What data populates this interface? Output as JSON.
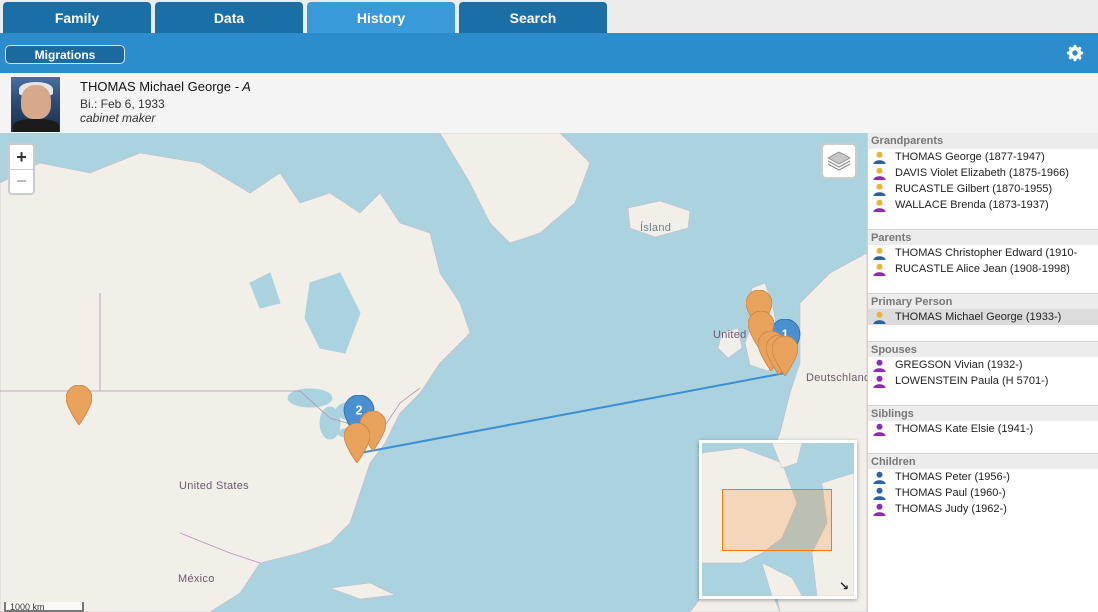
{
  "tabs": [
    {
      "label": "Family",
      "active": false
    },
    {
      "label": "Data",
      "active": false
    },
    {
      "label": "History",
      "active": true
    },
    {
      "label": "Search",
      "active": false
    }
  ],
  "toolbar": {
    "migrations_label": "Migrations",
    "settings_icon": "gear-icon"
  },
  "person": {
    "name": "THOMAS Michael George",
    "name_suffix": " - A",
    "birth": "Bi.: Feb 6, 1933",
    "occupation": "cabinet maker"
  },
  "map": {
    "zoom_in": "+",
    "zoom_out": "−",
    "labels": {
      "island": "Ísland",
      "united_kingdom": "United",
      "deutschland": "Deutschland",
      "united_states": "United States",
      "mexico": "México"
    },
    "scale": "1000 km",
    "marker_color": "#e8a25c",
    "cluster_color": "#4a90d0",
    "clusters": [
      {
        "count": "2"
      },
      {
        "count": "1"
      }
    ],
    "minimap_toggle": "↘"
  },
  "sidebar": {
    "sections": [
      {
        "title": "Grandparents",
        "people": [
          {
            "label": "THOMAS George (1877-1947)",
            "gender": "male"
          },
          {
            "label": "DAVIS Violet Elizabeth (1875-1966)",
            "gender": "female"
          },
          {
            "label": "RUCASTLE Gilbert (1870-1955)",
            "gender": "male"
          },
          {
            "label": "WALLACE Brenda (1873-1937)",
            "gender": "female"
          }
        ]
      },
      {
        "title": "Parents",
        "people": [
          {
            "label": "THOMAS Christopher Edward (1910-",
            "gender": "male"
          },
          {
            "label": "RUCASTLE Alice Jean (1908-1998)",
            "gender": "female"
          }
        ]
      },
      {
        "title": "Primary Person",
        "people": [
          {
            "label": "THOMAS Michael George (1933-)",
            "gender": "male",
            "selected": true
          }
        ]
      },
      {
        "title": "Spouses",
        "people": [
          {
            "label": "GREGSON Vivian (1932-)",
            "gender": "female"
          },
          {
            "label": "LOWENSTEIN Paula (H 5701-)",
            "gender": "female"
          }
        ]
      },
      {
        "title": "Siblings",
        "people": [
          {
            "label": "THOMAS Kate Elsie (1941-)",
            "gender": "female"
          }
        ]
      },
      {
        "title": "Children",
        "people": [
          {
            "label": "THOMAS Peter (1956-)",
            "gender": "male"
          },
          {
            "label": "THOMAS Paul (1960-)",
            "gender": "male"
          },
          {
            "label": "THOMAS Judy (1962-)",
            "gender": "female"
          }
        ]
      }
    ]
  }
}
